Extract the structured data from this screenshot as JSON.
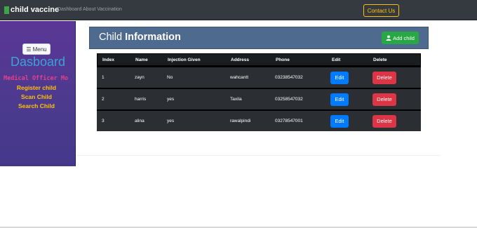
{
  "navbar": {
    "brand": "child vaccine",
    "links": [
      "Dashboard",
      "About Vaccination"
    ],
    "contact_label": "Contact Us"
  },
  "sidebar": {
    "menu_label": "Menu",
    "title": "Dasboard",
    "officer": "Medical Officer Mo",
    "links": [
      "Register child",
      "Scan Child",
      "Search Child"
    ]
  },
  "main": {
    "title_light": "Child ",
    "title_bold": "Information",
    "add_label": "Add child"
  },
  "table": {
    "headers": [
      "Index",
      "Name",
      "Injection Given",
      "Address",
      "Phone",
      "Edit",
      "Delete"
    ],
    "rows": [
      [
        "1",
        "zayn",
        "No",
        "wahcantt",
        "03238547032"
      ],
      [
        "2",
        "harris",
        "yes",
        "Taxila",
        "03258547032"
      ],
      [
        "3",
        "alina",
        "yes",
        "rawalpindi",
        "03278547001"
      ]
    ],
    "edit_label": "Edit",
    "delete_label": "Delete"
  },
  "colors": {
    "navbar": "#343a40",
    "sidebar": "#4b3a8e",
    "contact_outline": "#ffc107",
    "header_panel": "#4f6a8f",
    "add_button": "#28a745",
    "edit_button": "#007bff",
    "delete_button": "#dc3545"
  },
  "icons": [
    "hamburger-icon",
    "user-icon"
  ]
}
